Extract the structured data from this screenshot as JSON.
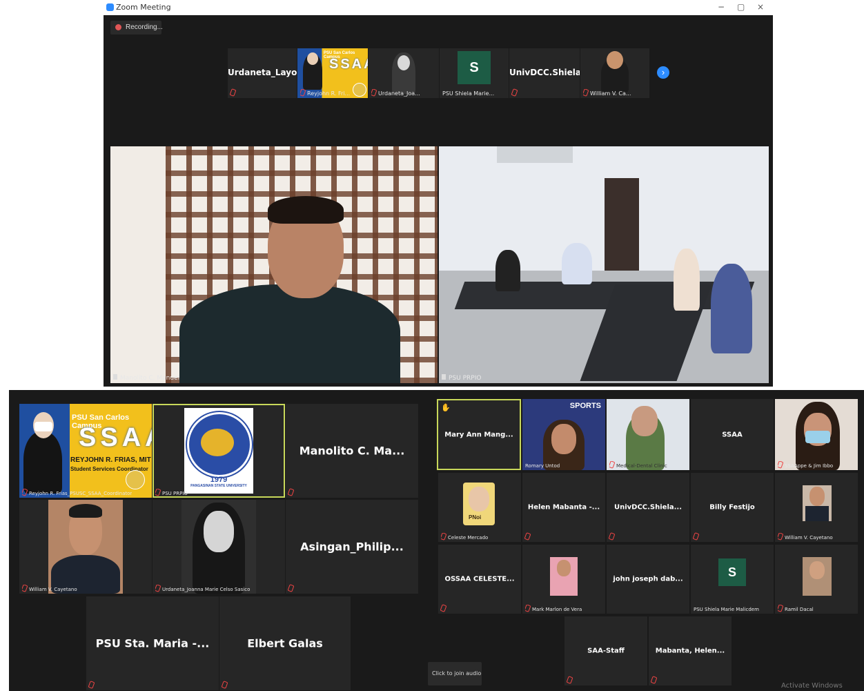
{
  "window": {
    "title": "Zoom Meeting",
    "controls": [
      "−",
      "▢",
      "×"
    ]
  },
  "recording": {
    "label": "Recording..."
  },
  "strip": [
    {
      "name": "Urdaneta_Layon...",
      "kind": "name"
    },
    {
      "name": "Reyjohn R. Fri...",
      "kind": "banner",
      "banner_small": "PSU San Carlos Campus",
      "banner_big": "SSAA"
    },
    {
      "name": "Urdaneta_Joa...",
      "kind": "photo"
    },
    {
      "name": "PSU Shiela Marie...",
      "kind": "initial",
      "initial": "S"
    },
    {
      "name": "UnivDCC.Shiela...",
      "kind": "name"
    },
    {
      "name": "William V. Ca...",
      "kind": "photo"
    }
  ],
  "main_videos": [
    {
      "name": "Manolito C. Manuel"
    },
    {
      "name": "PSU PRPIO"
    }
  ],
  "left_gallery": [
    {
      "name": "Reyjohn R. Frias_PSUSC_SSAA_Coordinator",
      "kind": "banner",
      "banner_small": "PSU San Carlos Campus",
      "banner_big": "SSAA",
      "banner_sub": "REYJOHN R. FRIAS, MIT",
      "banner_sub2": "Student Services Coordinator"
    },
    {
      "name": "PSU PRPIO",
      "kind": "logo",
      "logo_top": "PANGASINAN STATE UNIVERSITY",
      "logo_year": "1979"
    },
    {
      "name": "Manolito C. Ma...",
      "kind": "name"
    },
    {
      "name": "William V. Cayetano",
      "kind": "photo"
    },
    {
      "name": "Urdaneta_Joanna Marie Celso Sasico",
      "kind": "photo"
    },
    {
      "name": "Asingan_Philip...",
      "kind": "name"
    },
    {
      "name": "PSU Sta. Maria -...",
      "kind": "name"
    },
    {
      "name": "Elbert Galas",
      "kind": "name"
    }
  ],
  "right_gallery": [
    {
      "name": "Mary Ann Mang...",
      "kind": "name"
    },
    {
      "name": "Romary Untod",
      "kind": "photo",
      "banner": "SPORTS"
    },
    {
      "name": "Medical-Dental Clinic",
      "kind": "photo"
    },
    {
      "name": "SSAA",
      "kind": "name"
    },
    {
      "name": "SSAAppe & Jim Ibbo",
      "kind": "photo"
    },
    {
      "name": "Celeste Mercado",
      "kind": "photo",
      "badge": "PNoi"
    },
    {
      "name": "Helen Mabanta -...",
      "kind": "name"
    },
    {
      "name": "UnivDCC.Shiela...",
      "kind": "name"
    },
    {
      "name": "Billy Festijo",
      "kind": "name"
    },
    {
      "name": "William V. Cayetano",
      "kind": "photo"
    },
    {
      "name": "OSSAA CELESTE...",
      "kind": "name"
    },
    {
      "name": "Mark Marlon de Vera",
      "kind": "photo"
    },
    {
      "name": "john joseph dab...",
      "kind": "name"
    },
    {
      "name": "PSU Shiela Marie Malicdem",
      "kind": "initial",
      "initial": "S"
    },
    {
      "name": "Ramil Dacal",
      "kind": "photo"
    },
    {
      "name": "SAA-Staff",
      "kind": "name"
    },
    {
      "name": "Mabanta, Helen...",
      "kind": "name"
    }
  ],
  "audio": {
    "label": "Click to join audio"
  },
  "watermark": "Activate Windows"
}
